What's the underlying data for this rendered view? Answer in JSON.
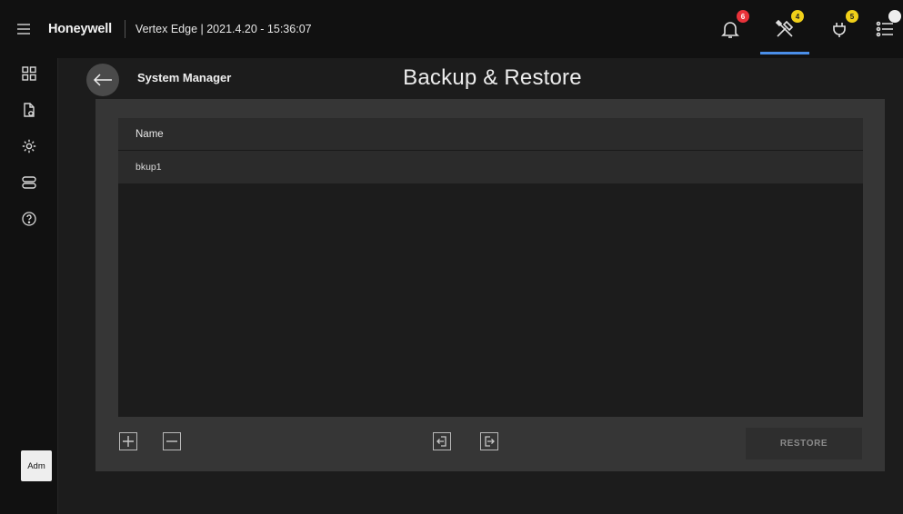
{
  "header": {
    "brand": "Honeywell",
    "subtitle": "Vertex Edge | 2021.4.20 - 15:36:07",
    "icons": [
      {
        "name": "bell-icon",
        "badge": "6",
        "badge_color": "#e8323a"
      },
      {
        "name": "tools-icon",
        "badge": "4",
        "badge_color": "#f1d019",
        "active": true
      },
      {
        "name": "plug-icon",
        "badge": "5",
        "badge_color": "#f1d019"
      },
      {
        "name": "list-icon",
        "badge": "",
        "badge_color": "#eeeeee"
      }
    ],
    "accent": "#4a8ee8"
  },
  "sidebar": {
    "items": [
      {
        "name": "sidebar-item-dashboard",
        "icon": "grid-icon"
      },
      {
        "name": "sidebar-item-documents",
        "icon": "document-icon"
      },
      {
        "name": "sidebar-item-settings",
        "icon": "gear-icon"
      },
      {
        "name": "sidebar-item-devices",
        "icon": "toggles-icon"
      },
      {
        "name": "sidebar-item-help",
        "icon": "help-icon"
      }
    ],
    "avatar": "Adm"
  },
  "page": {
    "breadcrumb": "System Manager",
    "title": "Backup & Restore"
  },
  "table": {
    "column_header": "Name",
    "rows": [
      "bkup1"
    ]
  },
  "toolbar": {
    "add_icon": "plus-box-icon",
    "remove_icon": "minus-box-icon",
    "import_icon": "import-icon",
    "export_icon": "export-icon",
    "restore_label": "RESTORE"
  }
}
